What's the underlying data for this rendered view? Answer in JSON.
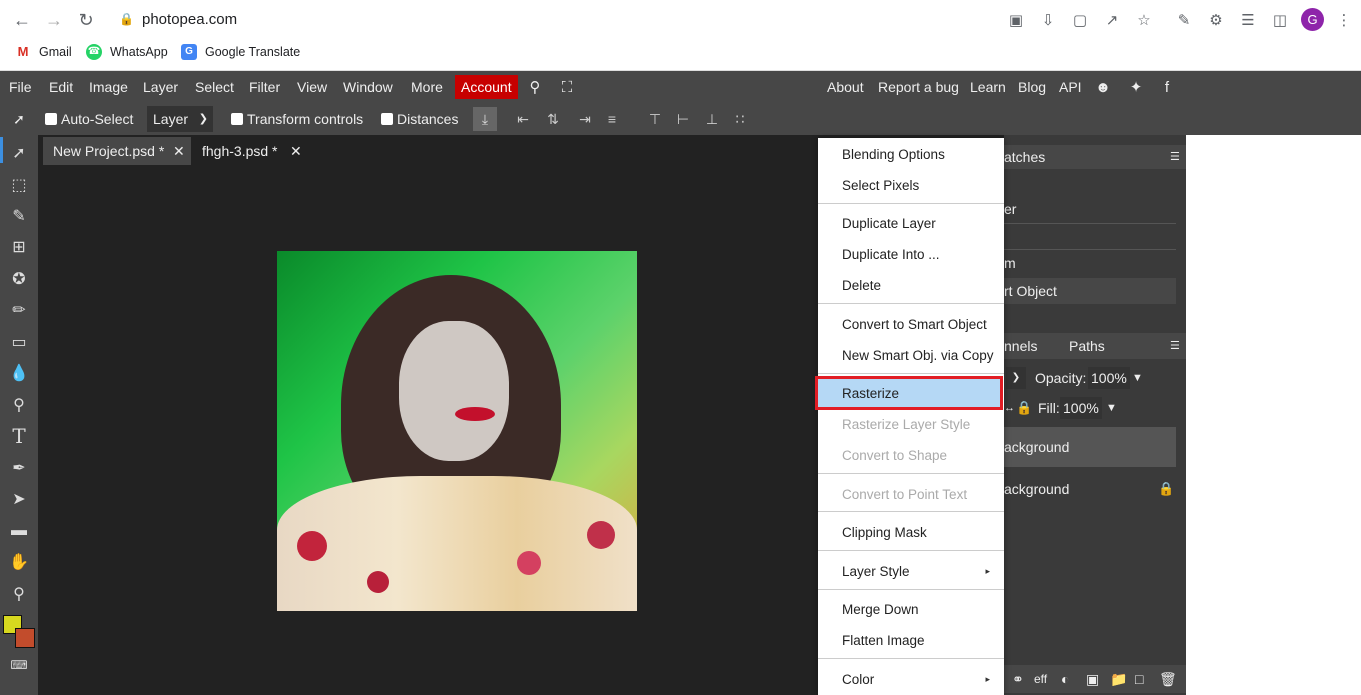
{
  "browser": {
    "url": "photopea.com",
    "bookmarks": [
      {
        "label": "Gmail"
      },
      {
        "label": "WhatsApp"
      },
      {
        "label": "Google Translate"
      }
    ],
    "avatar_letter": "G"
  },
  "menubar": {
    "items": [
      "File",
      "Edit",
      "Image",
      "Layer",
      "Select",
      "Filter",
      "View",
      "Window",
      "More"
    ],
    "account": "Account",
    "right_items": [
      "About",
      "Report a bug",
      "Learn",
      "Blog",
      "API"
    ]
  },
  "options": {
    "auto_select": "Auto-Select",
    "layer_select": "Layer",
    "transform_controls": "Transform controls",
    "distances": "Distances"
  },
  "tabs": [
    {
      "label": "New Project.psd *",
      "close": "✕"
    },
    {
      "label": "fhgh-3.psd *",
      "close": "✕"
    }
  ],
  "right_panel": {
    "swatches_title": "atches",
    "items": [
      "er",
      "m",
      "rt Object"
    ],
    "layer_tabs": [
      "nnels",
      "Paths"
    ],
    "opacity_label": "Opacity:",
    "opacity_value": "100%",
    "fill_label": "Fill:",
    "fill_value": "100%",
    "layers": [
      "ackground",
      "ackground"
    ]
  },
  "context_menu": {
    "items": [
      {
        "label": "Blending Options",
        "disabled": false
      },
      {
        "label": "Select Pixels",
        "disabled": false
      },
      {
        "label": "Duplicate Layer",
        "disabled": false
      },
      {
        "label": "Duplicate Into ...",
        "disabled": false
      },
      {
        "label": "Delete",
        "disabled": false
      },
      {
        "label": "Convert to Smart Object",
        "disabled": false
      },
      {
        "label": "New Smart Obj. via Copy",
        "disabled": false
      },
      {
        "label": "Rasterize",
        "disabled": false,
        "highlighted": true
      },
      {
        "label": "Rasterize Layer Style",
        "disabled": true
      },
      {
        "label": "Convert to Shape",
        "disabled": true
      },
      {
        "label": "Convert to Point Text",
        "disabled": true
      },
      {
        "label": "Clipping Mask",
        "disabled": false
      },
      {
        "label": "Layer Style",
        "disabled": false,
        "submenu": "▸"
      },
      {
        "label": "Merge Down",
        "disabled": false
      },
      {
        "label": "Flatten Image",
        "disabled": false
      },
      {
        "label": "Color",
        "disabled": false,
        "submenu": "▸"
      }
    ]
  },
  "colors": {
    "foreground": "#d7d81f",
    "background": "#c24c2c",
    "accent": "#c70000",
    "highlight": "#e21d25"
  }
}
